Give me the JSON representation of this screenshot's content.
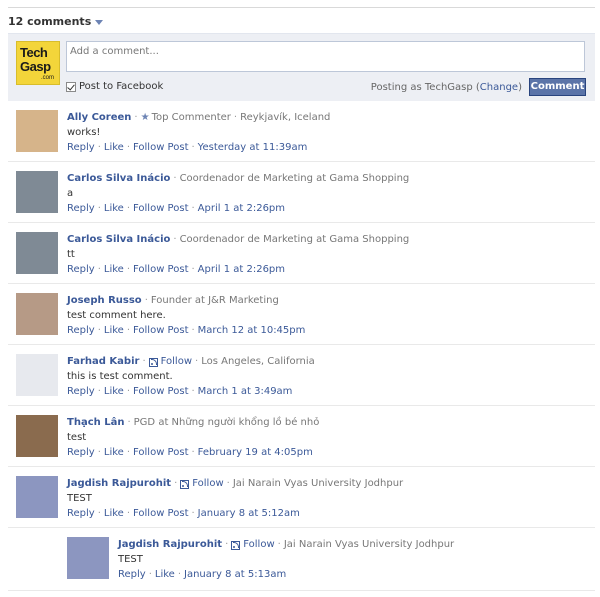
{
  "header": {
    "comment_count": "12 comments"
  },
  "composer": {
    "logo_line1": "Tech",
    "logo_line2": "Gasp",
    "logo_line3": ".com",
    "placeholder": "Add a comment...",
    "post_to_label": "Post to Facebook",
    "posting_as_prefix": "Posting as TechGasp (",
    "change_label": "Change",
    "posting_as_suffix": ")",
    "submit_label": "Comment"
  },
  "comments": [
    {
      "author": "Ally Coreen",
      "badge": "Top Commenter",
      "info": "Reykjavík, Iceland",
      "text": "works!",
      "reply": "Reply",
      "like": "Like",
      "follow_post": "Follow Post",
      "time": "Yesterday at 11:39am",
      "avatar_color": "#d6b48a"
    },
    {
      "author": "Carlos Silva Inácio",
      "info": "Coordenador de Marketing at Gama Shopping",
      "text": "a",
      "reply": "Reply",
      "like": "Like",
      "follow_post": "Follow Post",
      "time": "April 1 at 2:26pm",
      "avatar_color": "#7f8a95"
    },
    {
      "author": "Carlos Silva Inácio",
      "info": "Coordenador de Marketing at Gama Shopping",
      "text": "tt",
      "reply": "Reply",
      "like": "Like",
      "follow_post": "Follow Post",
      "time": "April 1 at 2:26pm",
      "avatar_color": "#7f8a95"
    },
    {
      "author": "Joseph Russo",
      "info": "Founder at J&R Marketing",
      "text": "test comment here.",
      "reply": "Reply",
      "like": "Like",
      "follow_post": "Follow Post",
      "time": "March 12 at 10:45pm",
      "avatar_color": "#b69a86"
    },
    {
      "author": "Farhad Kabir",
      "follow": "Follow",
      "info": "Los Angeles, California",
      "text": "this is test comment.",
      "reply": "Reply",
      "like": "Like",
      "follow_post": "Follow Post",
      "time": "March 1 at 3:49am",
      "avatar_color": "#e7e9ee"
    },
    {
      "author": "Thạch Lân",
      "info": "PGD at Những người khổng lồ bé nhỏ",
      "text": "test",
      "reply": "Reply",
      "like": "Like",
      "follow_post": "Follow Post",
      "time": "February 19 at 4:05pm",
      "avatar_color": "#8a6b4e"
    },
    {
      "author": "Jagdish Rajpurohit",
      "follow": "Follow",
      "info": "Jai Narain Vyas University Jodhpur",
      "text": "TEST",
      "reply": "Reply",
      "like": "Like",
      "follow_post": "Follow Post",
      "time": "January 8 at 5:12am",
      "avatar_color": "#8c96c0"
    },
    {
      "author": "Jagdish Rajpurohit",
      "follow": "Follow",
      "info": "Jai Narain Vyas University Jodhpur",
      "text": "TEST",
      "reply": "Reply",
      "like": "Like",
      "time": "January 8 at 5:13am",
      "avatar_color": "#8c96c0",
      "is_reply": true
    }
  ]
}
